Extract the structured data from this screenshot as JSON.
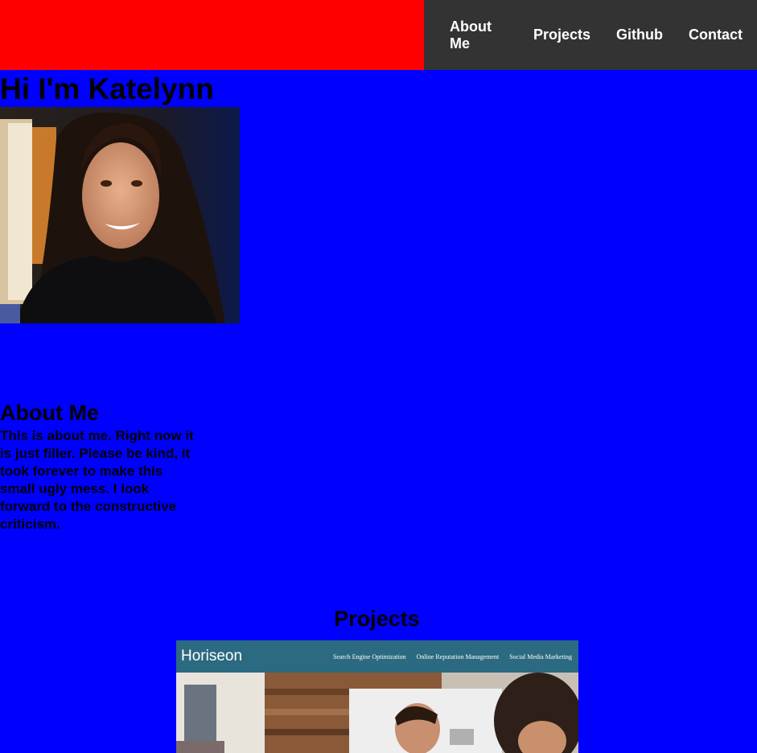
{
  "nav": {
    "items": [
      {
        "label": "About Me"
      },
      {
        "label": "Projects"
      },
      {
        "label": "Github"
      },
      {
        "label": "Contact"
      }
    ]
  },
  "hero": {
    "title": "Hi I'm Katelynn"
  },
  "about": {
    "heading": "About Me",
    "text": "This is about me. Right now it is just filler. Please be kind, it took forever to make this small ugly mess. I look forward to the constructive criticism."
  },
  "projects": {
    "heading": "Projects",
    "screenshot": {
      "logo": "Horiseon",
      "links": [
        "Search Engine Optimization",
        "Online Reputation Management",
        "Social Media Marketing"
      ]
    }
  },
  "colors": {
    "header_left": "#ff0000",
    "nav_bg": "#333333",
    "page_bg": "#0000ff"
  }
}
